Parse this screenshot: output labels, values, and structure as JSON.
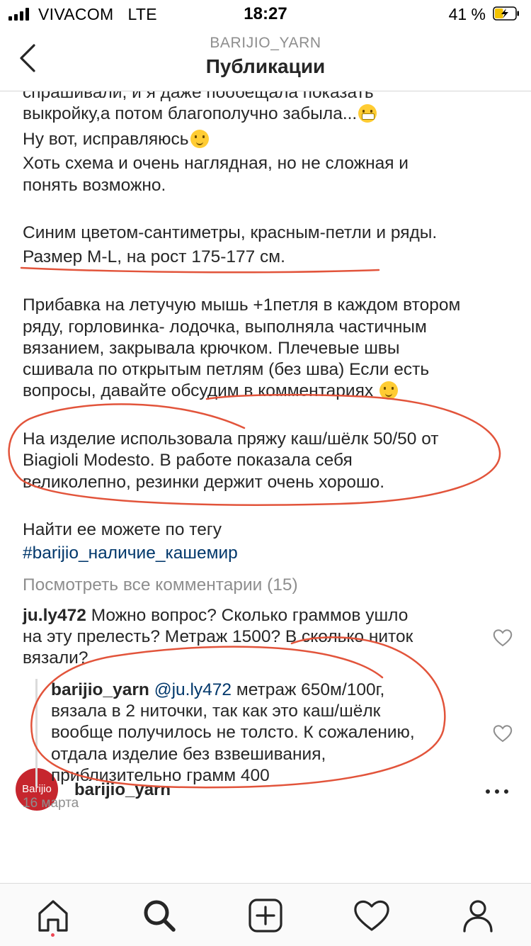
{
  "status_bar": {
    "carrier": "VIVACOM",
    "network": "LTE",
    "time": "18:27",
    "battery_percent": "41 %",
    "battery_level": 0.41
  },
  "header": {
    "account": "BARIJIO_YARN",
    "title": "Публикации"
  },
  "caption": {
    "lines": [
      "спрашивали, и я даже пообещала показать",
      "выкройку,а потом благополучно забыла...",
      "Ну вот, исправляюсь",
      "Хоть схема и очень наглядная, но не сложная и",
      "понять возможно.",
      "Синим цветом-сантиметры, красным-петли и ряды.",
      "Размер M-L, на рост 175-177 см.",
      "Прибавка на летучую мышь +1петля в каждом втором",
      "ряду, горловинка- лодочка, выполняла частичным",
      "вязанием, закрывала крючком. Плечевые швы",
      "сшивала по открытым петлям (без шва)  Если есть",
      "вопросы, давайте обсудим в комментариях",
      "На изделие использовала пряжу каш/шёлк 50/50 от",
      "Biagioli Modesto. В работе показала себя",
      "великолепно, резинки держит очень хорошо.",
      "Найти ее можете по тегу"
    ],
    "hashtag": "#barijio_наличие_кашемир",
    "emoji": [
      "grinning-face-emoji",
      "winking-face-emoji"
    ]
  },
  "view_all_comments": "Посмотреть все комментарии (15)",
  "comments": [
    {
      "user": "ju.ly472",
      "lines": [
        "Можно вопрос? Сколько граммов ушло",
        "на эту прелесть?  Метраж 1500? В сколько ниток",
        "вязали?"
      ]
    },
    {
      "user": "barijio_yarn",
      "mention": "@ju.ly472",
      "lines": [
        "метраж 650м/100г,",
        "вязала в 2 ниточки, так как это каш/шёлк",
        "вообще получилось не толсто. К сожалению,",
        "отдала изделие без взвешивания,",
        "приблизительно грамм 400"
      ]
    }
  ],
  "post_date": "16 марта",
  "next_post": {
    "avatar_text": "Barijio",
    "user": "barijio_yarn"
  },
  "tab_bar": {
    "tabs": [
      "home-icon",
      "search-icon",
      "new-post-icon",
      "activity-heart-icon",
      "profile-icon"
    ]
  },
  "colors": {
    "text": "#262626",
    "muted": "#8e8e8e",
    "link": "#00376b",
    "annotation_red": "#e2543b",
    "notification_dot": "#ed4956"
  }
}
